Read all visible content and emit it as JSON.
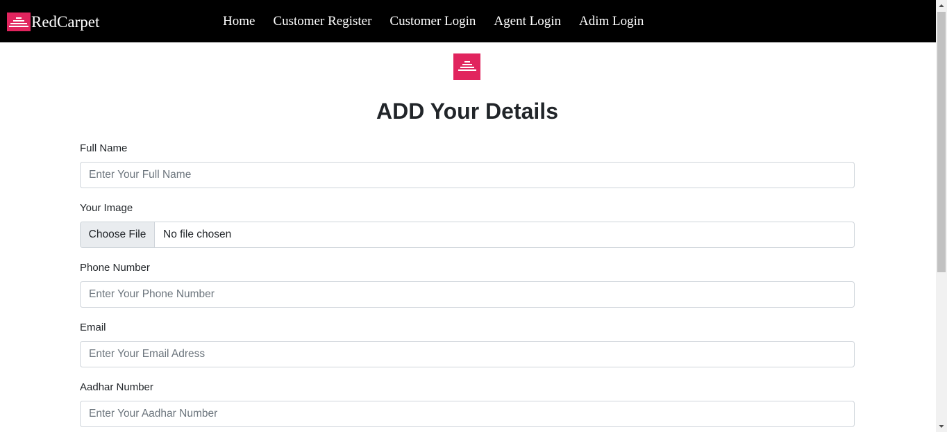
{
  "navbar": {
    "brand_name": "RedCarpet",
    "brand_logo": "redcarpet-stairs-logo",
    "links": [
      "Home",
      "Customer Register",
      "Customer Login",
      "Agent Login",
      "Adim Login"
    ]
  },
  "form": {
    "logo": "redcarpet-stairs-logo",
    "title": "ADD Your Details",
    "full_name": {
      "label": "Full Name",
      "placeholder": "Enter Your Full Name",
      "value": ""
    },
    "image": {
      "label": "Your Image",
      "button_label": "Choose File",
      "status": "No file chosen"
    },
    "phone": {
      "label": "Phone Number",
      "placeholder": "Enter Your Phone Number",
      "value": ""
    },
    "email": {
      "label": "Email",
      "placeholder": "Enter Your Email Adress",
      "value": ""
    },
    "aadhar": {
      "label": "Aadhar Number",
      "placeholder": "Enter Your Aadhar Number",
      "value": ""
    }
  },
  "colors": {
    "navbar_bg": "#000000",
    "brand_accent": "#e1245e",
    "input_border": "#ced4da",
    "placeholder": "#6c757d"
  }
}
